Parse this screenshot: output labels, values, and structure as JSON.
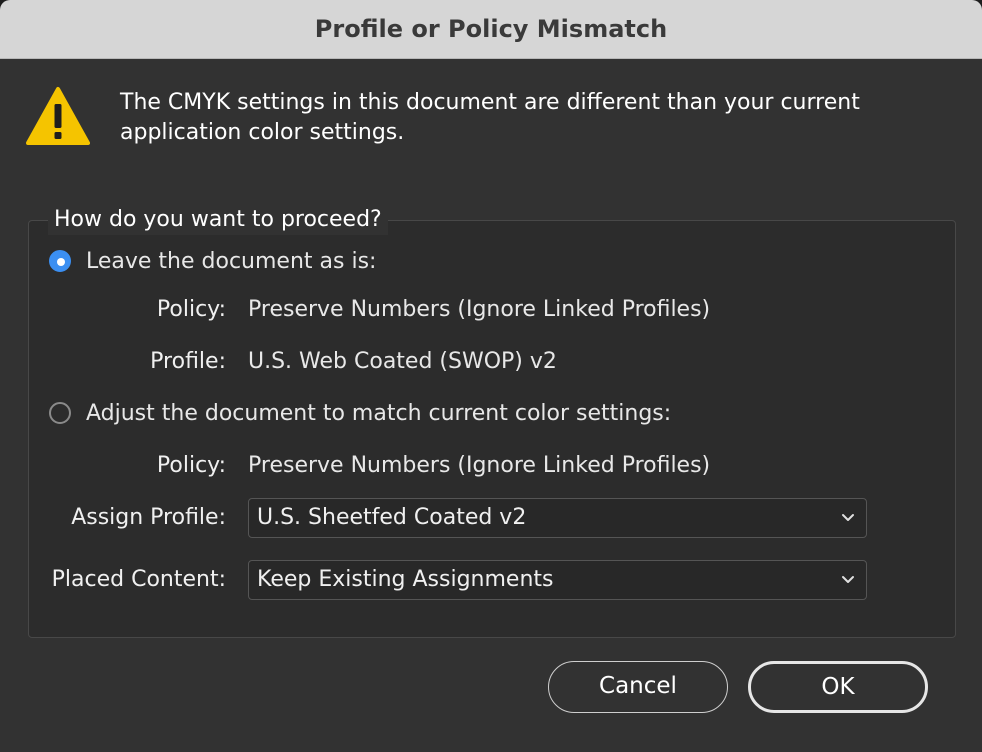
{
  "dialog": {
    "title": "Profile or Policy Mismatch",
    "message": "The CMYK settings in this document are different than your current application color settings."
  },
  "group": {
    "legend": "How do you want to proceed?"
  },
  "option_leave": {
    "label": "Leave the document as is:",
    "selected": true,
    "policy_label": "Policy:",
    "policy_value": "Preserve Numbers (Ignore Linked Profiles)",
    "profile_label": "Profile:",
    "profile_value": "U.S. Web Coated (SWOP) v2"
  },
  "option_adjust": {
    "label": "Adjust the document to match current color settings:",
    "selected": false,
    "policy_label": "Policy:",
    "policy_value": "Preserve Numbers (Ignore Linked Profiles)",
    "assign_profile_label": "Assign Profile:",
    "assign_profile_value": "U.S. Sheetfed Coated v2",
    "placed_content_label": "Placed Content:",
    "placed_content_value": "Keep Existing Assignments"
  },
  "buttons": {
    "cancel": "Cancel",
    "ok": "OK"
  },
  "colors": {
    "accent": "#3b8ff2",
    "warning": "#f5c400"
  },
  "icons": {
    "warning": "warning-triangle-icon",
    "dropdown": "chevron-down-icon"
  }
}
